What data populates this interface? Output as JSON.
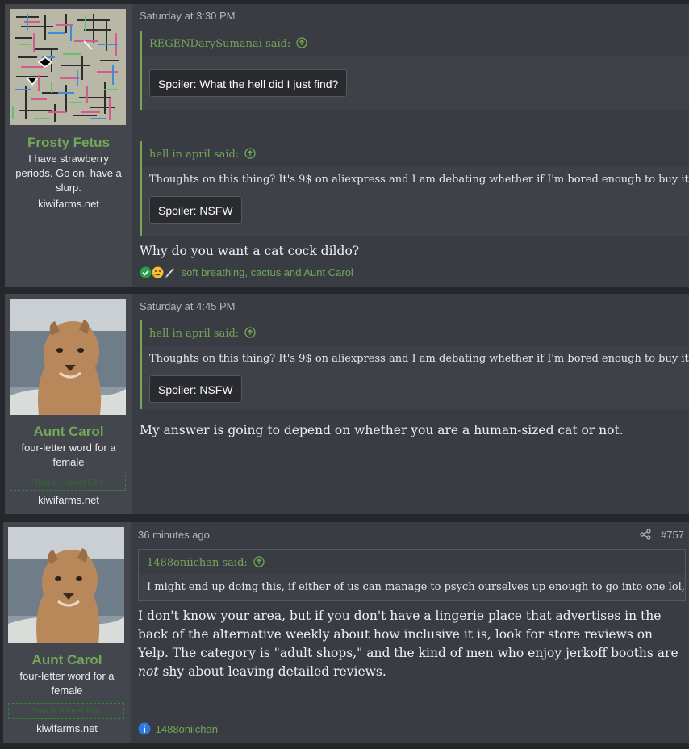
{
  "posts": [
    {
      "author": "Frosty Fetus",
      "user_title": "I have strawberry periods. Go on, have a slurp.",
      "site": "kiwifarms.net",
      "time": "Saturday at 3:30 PM",
      "quotes": [
        {
          "author": "REGENDarySumanai said:",
          "spoiler": "Spoiler: What the hell did I just find?"
        },
        {
          "author": "hell in april said:",
          "text": "Thoughts on this thing? It's 9$ on aliexpress and I am debating whether if I'm bored enough to buy it",
          "spoiler": "Spoiler: NSFW"
        }
      ],
      "body": "Why do you want a cat cock dildo?",
      "reactions": "soft breathing, cactus and Aunt Carol"
    },
    {
      "author": "Aunt Carol",
      "user_title": "four-letter word for a female",
      "badge": "True & Honest Fan",
      "site": "kiwifarms.net",
      "time": "Saturday at 4:45 PM",
      "quotes": [
        {
          "author": "hell in april said:",
          "text": "Thoughts on this thing? It's 9$ on aliexpress and I am debating whether if I'm bored enough to buy it",
          "spoiler": "Spoiler: NSFW"
        }
      ],
      "body": "My answer is going to depend on whether you are a human-sized cat or not."
    },
    {
      "author": "Aunt Carol",
      "user_title": "four-letter word for a female",
      "badge": "True & Honest Fan",
      "site": "kiwifarms.net",
      "time": "36 minutes ago",
      "post_number": "#757",
      "quotes": [
        {
          "author": "1488oniichan said:",
          "text": "I might end up doing this, if either of us can manage to psych ourselves up enough to go into one lol,"
        }
      ],
      "body_before": "I don't know your area, but if you don't have a lingerie place that advertises in the back of the alternative weekly about how inclusive it is, look for store reviews on Yelp. The category is \"adult shops,\" and the kind of men who enjoy jerkoff booths are ",
      "body_em": "not",
      "body_after": " shy about leaving detailed reviews.",
      "reactions": "1488oniichan"
    }
  ],
  "colors": {
    "accent": "#73a857",
    "background": "#26272b",
    "post_bg": "#3a3c43",
    "user_bg": "#44464d"
  },
  "icons": {
    "quote_link": "arrow-up-circle-icon",
    "share": "share-icon",
    "reaction_check": "check-circle-icon",
    "reaction_thinking": "thinking-face-icon",
    "reaction_cactus": "cactus-icon",
    "reaction_info": "info-icon"
  }
}
